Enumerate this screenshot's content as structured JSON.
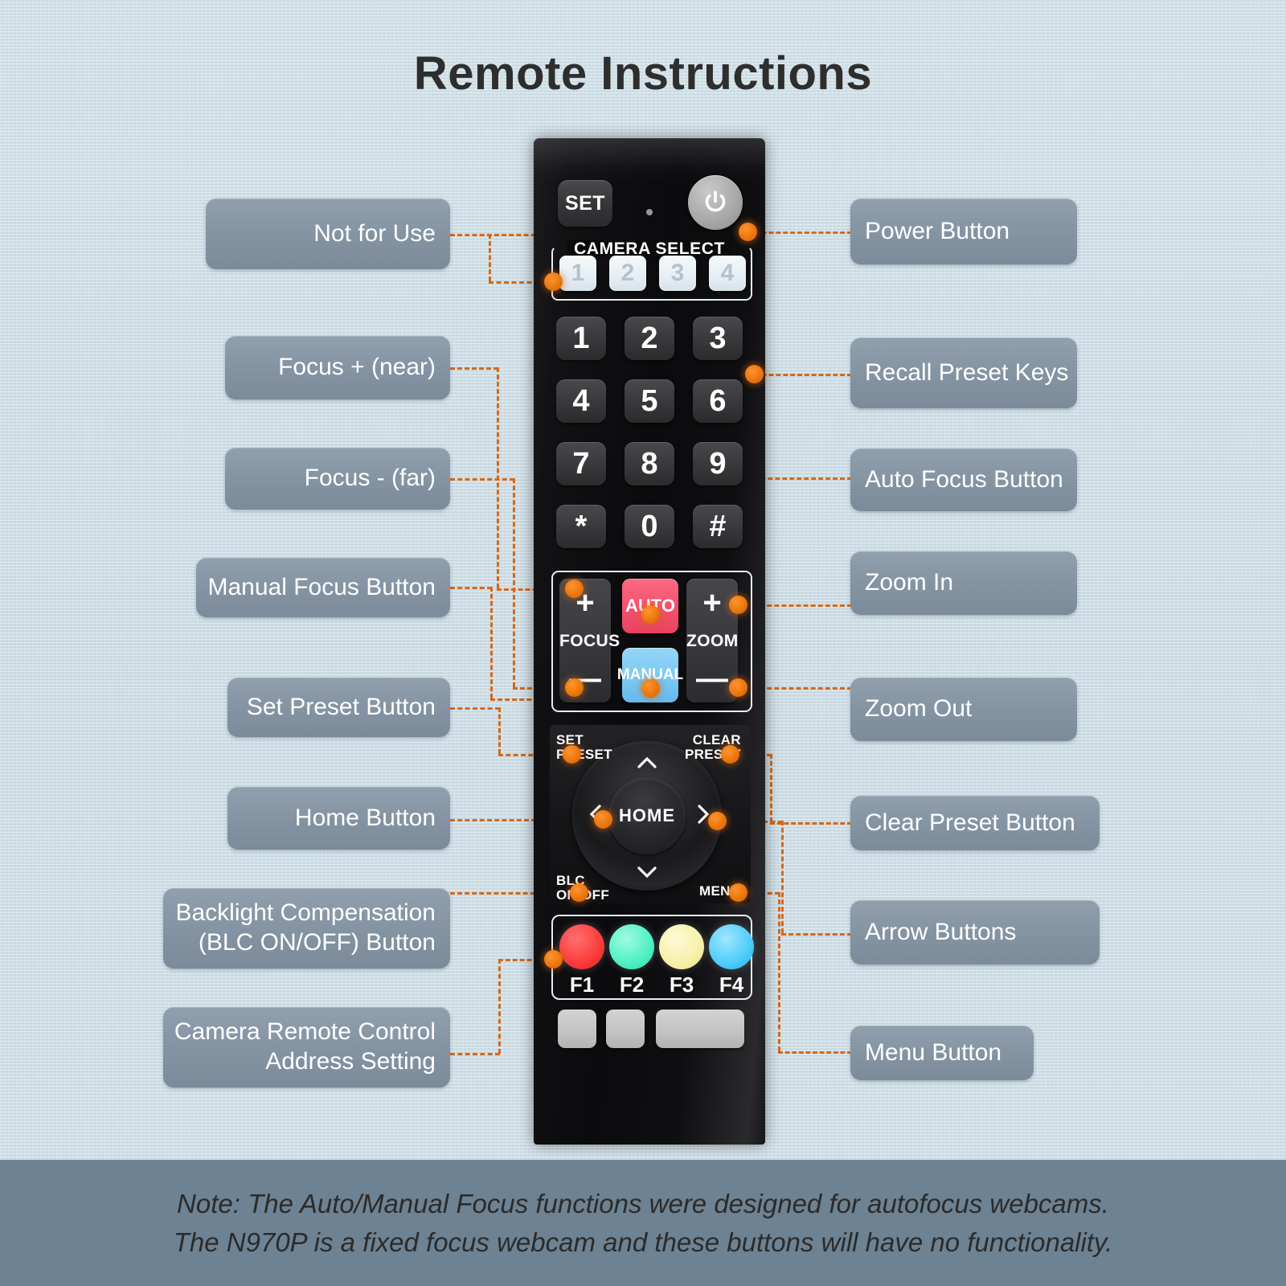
{
  "page": {
    "title": "Remote Instructions",
    "background_color": "#c9dbe3",
    "accent_color": "#d4691b",
    "label_color": "#8695a4"
  },
  "callouts_left": [
    {
      "name": "not-for-use",
      "lines": [
        "Not for Use"
      ]
    },
    {
      "name": "focus-near",
      "lines": [
        "Focus + (near)"
      ]
    },
    {
      "name": "focus-far",
      "lines": [
        "Focus - (far)"
      ]
    },
    {
      "name": "manual-focus",
      "lines": [
        "Manual Focus Button"
      ]
    },
    {
      "name": "set-preset",
      "lines": [
        "Set Preset Button"
      ]
    },
    {
      "name": "home",
      "lines": [
        "Home Button"
      ]
    },
    {
      "name": "blc",
      "lines": [
        "Backlight Compensation",
        "(BLC ON/OFF) Button"
      ]
    },
    {
      "name": "address",
      "lines": [
        "Camera Remote Control",
        "Address Setting"
      ]
    }
  ],
  "callouts_right": [
    {
      "name": "power",
      "lines": [
        "Power Button"
      ]
    },
    {
      "name": "recall-preset",
      "lines": [
        "Recall Preset Keys"
      ]
    },
    {
      "name": "auto-focus",
      "lines": [
        "Auto Focus Button"
      ]
    },
    {
      "name": "zoom-in",
      "lines": [
        "Zoom In"
      ]
    },
    {
      "name": "zoom-out",
      "lines": [
        "Zoom Out"
      ]
    },
    {
      "name": "clear-preset",
      "lines": [
        "Clear Preset Button"
      ]
    },
    {
      "name": "arrows",
      "lines": [
        "Arrow Buttons"
      ]
    },
    {
      "name": "menu",
      "lines": [
        "Menu Button"
      ]
    }
  ],
  "remote": {
    "set_label": "SET",
    "power_icon": "power-icon",
    "camera_select_title": "CAMERA SELECT",
    "camera_select_keys": [
      "1",
      "2",
      "3",
      "4"
    ],
    "keypad": [
      "1",
      "2",
      "3",
      "4",
      "5",
      "6",
      "7",
      "8",
      "9",
      "*",
      "0",
      "#"
    ],
    "focus": {
      "name": "FOCUS",
      "plus": "+",
      "minus": "—"
    },
    "zoom": {
      "name": "ZOOM",
      "plus": "+",
      "minus": "—"
    },
    "auto_label": "AUTO",
    "auto_color": "#f4506c",
    "manual_label": "MANUAL",
    "manual_color": "#7cc9f3",
    "set_preset_label": [
      "SET",
      "PRESET"
    ],
    "clear_preset_label": [
      "CLEAR",
      "PRESET"
    ],
    "blc_label": [
      "BLC",
      "ON/OFF"
    ],
    "menu_label": "MENU",
    "home_label": "HOME",
    "function_keys": [
      {
        "label": "F1",
        "color": "#fc3b3b"
      },
      {
        "label": "F2",
        "color": "#4ff0c4"
      },
      {
        "label": "F3",
        "color": "#f7f0a8"
      },
      {
        "label": "F4",
        "color": "#4ecdfa"
      }
    ]
  },
  "footer": {
    "lines": [
      "Note: The Auto/Manual Focus functions were designed for autofocus webcams.",
      "The N970P is a fixed focus webcam and these buttons will have no functionality."
    ]
  }
}
